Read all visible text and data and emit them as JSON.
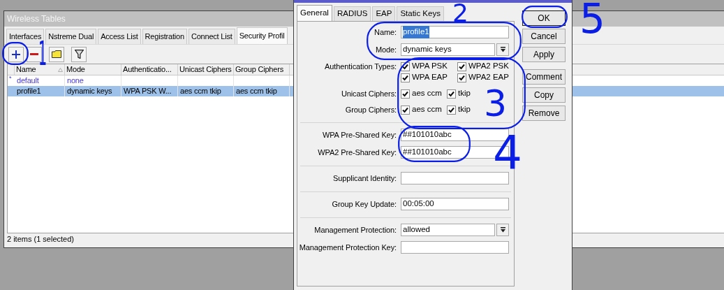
{
  "main_window": {
    "title": "Wireless Tables",
    "tabs": [
      {
        "label": "Interfaces",
        "selected": false
      },
      {
        "label": "Nstreme Dual",
        "selected": false
      },
      {
        "label": "Access List",
        "selected": false
      },
      {
        "label": "Registration",
        "selected": false
      },
      {
        "label": "Connect List",
        "selected": false
      },
      {
        "label": "Security Profil",
        "selected": true
      }
    ],
    "toolbar": [
      {
        "kind": "add"
      },
      {
        "kind": "remove"
      },
      {
        "kind": "comment"
      },
      {
        "kind": "filter"
      }
    ],
    "table": {
      "columns": [
        "Name",
        "Mode",
        "Authenticatio...",
        "Unicast Ciphers",
        "Group Ciphers"
      ],
      "rows": [
        {
          "flag": "*",
          "is_default": true,
          "selected": false,
          "cells": [
            "default",
            "none",
            "",
            "",
            ""
          ]
        },
        {
          "is_default": false,
          "selected": true,
          "cells": [
            "profile1",
            "dynamic keys",
            "WPA PSK W...",
            "aes ccm tkip",
            "aes ccm tkip"
          ]
        }
      ]
    },
    "status_bar": "2 items (1 selected)"
  },
  "dialog": {
    "tabs": [
      {
        "label": "General",
        "selected": true
      },
      {
        "label": "RADIUS",
        "selected": false
      },
      {
        "label": "EAP",
        "selected": false
      },
      {
        "label": "Static Keys",
        "selected": false
      }
    ],
    "sections": [
      [
        {
          "kind": "text",
          "label": "Name:",
          "value": "profile1",
          "text_selected": true
        },
        {
          "kind": "select",
          "label": "Mode:",
          "value": "dynamic keys"
        },
        {
          "kind": "checks",
          "label": "Authentication Types:",
          "options": [
            {
              "label": "WPA PSK",
              "checked": true
            },
            {
              "label": "WPA2 PSK",
              "checked": true
            },
            {
              "label": "WPA EAP",
              "checked": true
            },
            {
              "label": "WPA2 EAP",
              "checked": true
            }
          ]
        },
        {
          "kind": "checks",
          "label": "Unicast Ciphers:",
          "options": [
            {
              "label": "aes ccm",
              "checked": true
            },
            {
              "label": "tkip",
              "checked": true
            }
          ]
        },
        {
          "kind": "checks",
          "label": "Group Ciphers:",
          "options": [
            {
              "label": "aes ccm",
              "checked": true
            },
            {
              "label": "tkip",
              "checked": true
            }
          ]
        }
      ],
      [
        {
          "kind": "text",
          "label": "WPA Pre-Shared Key:",
          "value": "##101010abc"
        },
        {
          "kind": "text",
          "label": "WPA2 Pre-Shared Key:",
          "value": "##101010abc"
        }
      ],
      [
        {
          "kind": "text",
          "label": "Supplicant Identity:"
        }
      ],
      [
        {
          "kind": "text",
          "label": "Group Key Update:",
          "value": "00:05:00"
        }
      ],
      [
        {
          "kind": "select",
          "label": "Management Protection:",
          "value": "allowed"
        },
        {
          "kind": "text",
          "label": "Management Protection Key:"
        }
      ]
    ],
    "buttons": [
      {
        "label": "OK",
        "default": true
      },
      {
        "label": "Cancel",
        "default": false
      },
      {
        "label": "Apply",
        "default": false
      },
      {
        "label": "Comment",
        "default": false
      },
      {
        "label": "Copy",
        "default": false
      },
      {
        "label": "Remove",
        "default": false
      }
    ]
  },
  "annotations": [
    {
      "label": "1"
    },
    {
      "label": "2"
    },
    {
      "label": "3"
    },
    {
      "label": "4"
    },
    {
      "label": "5"
    }
  ]
}
